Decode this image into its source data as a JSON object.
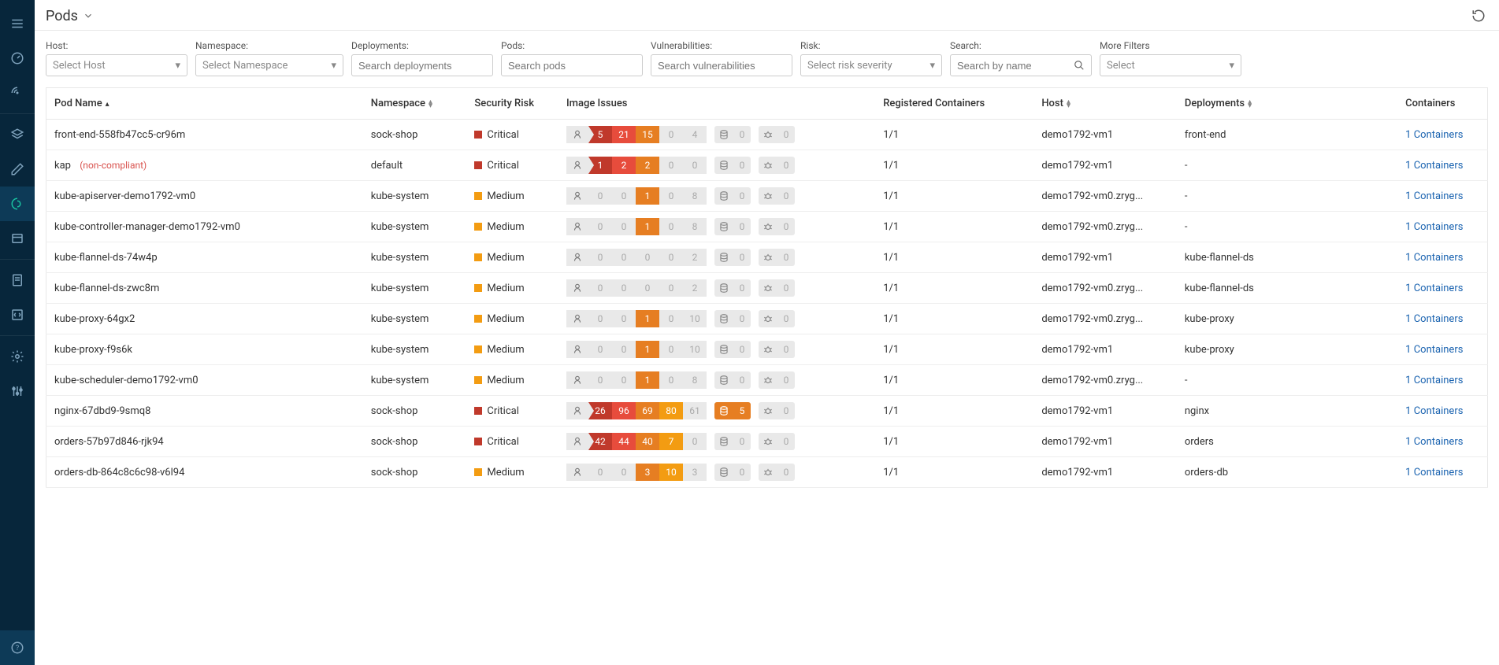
{
  "header": {
    "title": "Pods"
  },
  "filters": {
    "host": {
      "label": "Host:",
      "placeholder": "Select Host"
    },
    "ns": {
      "label": "Namespace:",
      "placeholder": "Select Namespace"
    },
    "dep": {
      "label": "Deployments:",
      "placeholder": "Search deployments"
    },
    "pods": {
      "label": "Pods:",
      "placeholder": "Search pods"
    },
    "vuln": {
      "label": "Vulnerabilities:",
      "placeholder": "Search vulnerabilities"
    },
    "risk": {
      "label": "Risk:",
      "placeholder": "Select risk severity"
    },
    "search": {
      "label": "Search:",
      "placeholder": "Search by name"
    },
    "more": {
      "label": "More Filters",
      "placeholder": "Select"
    }
  },
  "columns": {
    "name": "Pod Name",
    "ns": "Namespace",
    "risk": "Security Risk",
    "issues": "Image Issues",
    "reg": "Registered Containers",
    "host": "Host",
    "dep": "Deployments",
    "cont": "Containers"
  },
  "container_link": "1 Containers",
  "rows": [
    {
      "name": "front-end-558fb47cc5-cr96m",
      "nc": false,
      "ns": "sock-shop",
      "risk": "Critical",
      "v": [
        5,
        21,
        15,
        0,
        4
      ],
      "db": 0,
      "db_hot": false,
      "bug": 0,
      "reg": "1/1",
      "host": "demo1792-vm1",
      "dep": "front-end"
    },
    {
      "name": "kap",
      "nc": true,
      "ns": "default",
      "risk": "Critical",
      "v": [
        1,
        2,
        2,
        0,
        0
      ],
      "db": 0,
      "db_hot": false,
      "bug": 0,
      "reg": "1/1",
      "host": "demo1792-vm1",
      "dep": "-"
    },
    {
      "name": "kube-apiserver-demo1792-vm0",
      "nc": false,
      "ns": "kube-system",
      "risk": "Medium",
      "v": [
        0,
        0,
        1,
        0,
        8
      ],
      "db": 0,
      "db_hot": false,
      "bug": 0,
      "reg": "1/1",
      "host": "demo1792-vm0.zryg...",
      "dep": "-"
    },
    {
      "name": "kube-controller-manager-demo1792-vm0",
      "nc": false,
      "ns": "kube-system",
      "risk": "Medium",
      "v": [
        0,
        0,
        1,
        0,
        8
      ],
      "db": 0,
      "db_hot": false,
      "bug": 0,
      "reg": "1/1",
      "host": "demo1792-vm0.zryg...",
      "dep": "-"
    },
    {
      "name": "kube-flannel-ds-74w4p",
      "nc": false,
      "ns": "kube-system",
      "risk": "Medium",
      "v": [
        0,
        0,
        0,
        0,
        2
      ],
      "db": 0,
      "db_hot": false,
      "bug": 0,
      "reg": "1/1",
      "host": "demo1792-vm1",
      "dep": "kube-flannel-ds"
    },
    {
      "name": "kube-flannel-ds-zwc8m",
      "nc": false,
      "ns": "kube-system",
      "risk": "Medium",
      "v": [
        0,
        0,
        0,
        0,
        2
      ],
      "db": 0,
      "db_hot": false,
      "bug": 0,
      "reg": "1/1",
      "host": "demo1792-vm0.zryg...",
      "dep": "kube-flannel-ds"
    },
    {
      "name": "kube-proxy-64gx2",
      "nc": false,
      "ns": "kube-system",
      "risk": "Medium",
      "v": [
        0,
        0,
        1,
        0,
        10
      ],
      "db": 0,
      "db_hot": false,
      "bug": 0,
      "reg": "1/1",
      "host": "demo1792-vm0.zryg...",
      "dep": "kube-proxy"
    },
    {
      "name": "kube-proxy-f9s6k",
      "nc": false,
      "ns": "kube-system",
      "risk": "Medium",
      "v": [
        0,
        0,
        1,
        0,
        10
      ],
      "db": 0,
      "db_hot": false,
      "bug": 0,
      "reg": "1/1",
      "host": "demo1792-vm1",
      "dep": "kube-proxy"
    },
    {
      "name": "kube-scheduler-demo1792-vm0",
      "nc": false,
      "ns": "kube-system",
      "risk": "Medium",
      "v": [
        0,
        0,
        1,
        0,
        8
      ],
      "db": 0,
      "db_hot": false,
      "bug": 0,
      "reg": "1/1",
      "host": "demo1792-vm0.zryg...",
      "dep": "-"
    },
    {
      "name": "nginx-67dbd9-9smq8",
      "nc": false,
      "ns": "sock-shop",
      "risk": "Critical",
      "v": [
        26,
        96,
        69,
        80,
        61
      ],
      "db": 5,
      "db_hot": true,
      "bug": 0,
      "reg": "1/1",
      "host": "demo1792-vm1",
      "dep": "nginx"
    },
    {
      "name": "orders-57b97d846-rjk94",
      "nc": false,
      "ns": "sock-shop",
      "risk": "Critical",
      "v": [
        42,
        44,
        40,
        7,
        0
      ],
      "db": 0,
      "db_hot": false,
      "bug": 0,
      "reg": "1/1",
      "host": "demo1792-vm1",
      "dep": "orders"
    },
    {
      "name": "orders-db-864c8c6c98-v6l94",
      "nc": false,
      "ns": "sock-shop",
      "risk": "Medium",
      "v": [
        0,
        0,
        3,
        10,
        3
      ],
      "db": 0,
      "db_hot": false,
      "bug": 0,
      "reg": "1/1",
      "host": "demo1792-vm1",
      "dep": "orders-db"
    }
  ],
  "noncompliant_label": "(non-compliant)"
}
